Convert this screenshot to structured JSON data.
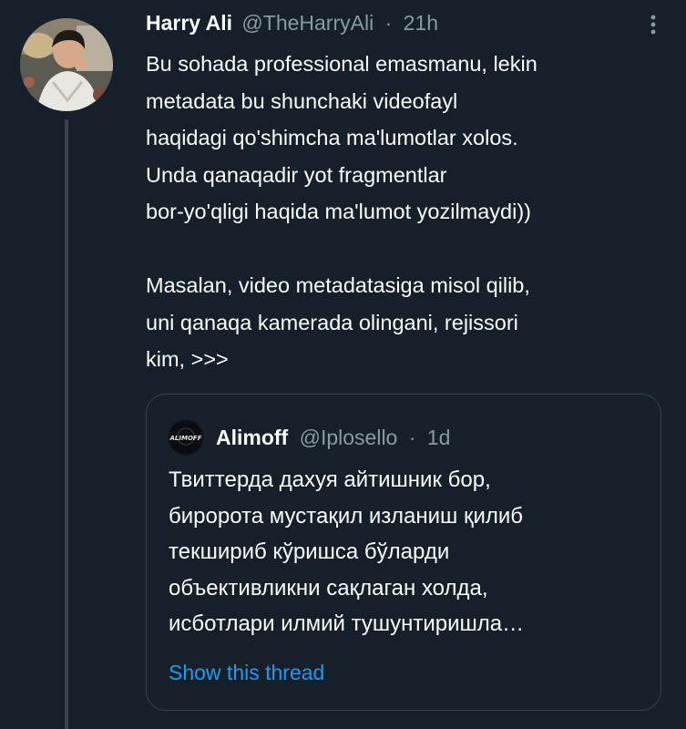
{
  "tweet": {
    "author_name": "Harry Ali",
    "author_handle": "@TheHarryAli",
    "separator": "·",
    "time": "21h",
    "text": "Bu sohada professional emasmanu, lekin\nmetadata bu shunchaki videofayl\nhaqidagi qo'shimcha ma'lumotlar xolos.\nUnda qanaqadir yot fragmentlar\nbor-yo'qligi haqida ma'lumot yozilmaydi))\n\nMasalan, video metadatasiga misol qilib,\nuni qanaqa kamerada olingani, rejissori\nkim, >>>",
    "more_icon": "more-vertical-icon"
  },
  "quoted_tweet": {
    "author_name": "Alimoff",
    "author_handle": "@Iplosello",
    "separator": "·",
    "time": "1d",
    "avatar_text": "ALIMOFF",
    "text": "Твиттерда дахуя айтишник бор,\nбиророта мустақил изланиш қилиб\nтекшириб кўришса бўларди\nобъективликни сақлаган холда,\nисботлари илмий тушунтиришла…",
    "show_thread": "Show this thread"
  },
  "colors": {
    "background": "#15202b",
    "text": "#ffffff",
    "secondary": "#8b98a5",
    "border": "#38444d",
    "link": "#1d9bf0"
  }
}
